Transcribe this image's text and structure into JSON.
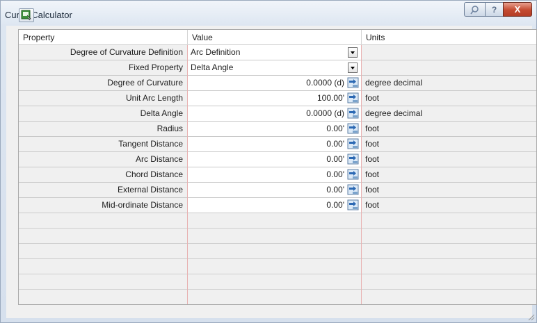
{
  "window": {
    "title": "Curve Calculator",
    "buttons": {
      "pin_icon": "pushpin-icon",
      "help_label": "?",
      "close_label": "X"
    }
  },
  "toolbar": {
    "icon": "curve-calculator-icon"
  },
  "grid": {
    "columns": [
      "Property",
      "Value",
      "Units"
    ],
    "rows": [
      {
        "property": "Degree of Curvature Definition",
        "value": "Arc Definition",
        "units": "",
        "control": "dropdown"
      },
      {
        "property": "Fixed Property",
        "value": "Delta Angle",
        "units": "",
        "control": "dropdown"
      },
      {
        "property": "Degree of Curvature",
        "value": "0.0000 (d)",
        "units": "degree decimal",
        "control": "pick"
      },
      {
        "property": "Unit Arc Length",
        "value": "100.00'",
        "units": "foot",
        "control": "pick"
      },
      {
        "property": "Delta Angle",
        "value": "0.0000 (d)",
        "units": "degree decimal",
        "control": "pick"
      },
      {
        "property": "Radius",
        "value": "0.00'",
        "units": "foot",
        "control": "pick"
      },
      {
        "property": "Tangent Distance",
        "value": "0.00'",
        "units": "foot",
        "control": "pick"
      },
      {
        "property": "Arc Distance",
        "value": "0.00'",
        "units": "foot",
        "control": "pick"
      },
      {
        "property": "Chord Distance",
        "value": "0.00'",
        "units": "foot",
        "control": "pick"
      },
      {
        "property": "External Distance",
        "value": "0.00'",
        "units": "foot",
        "control": "pick"
      },
      {
        "property": "Mid-ordinate Distance",
        "value": "0.00'",
        "units": "foot",
        "control": "pick"
      }
    ],
    "empty_rows": 5
  }
}
